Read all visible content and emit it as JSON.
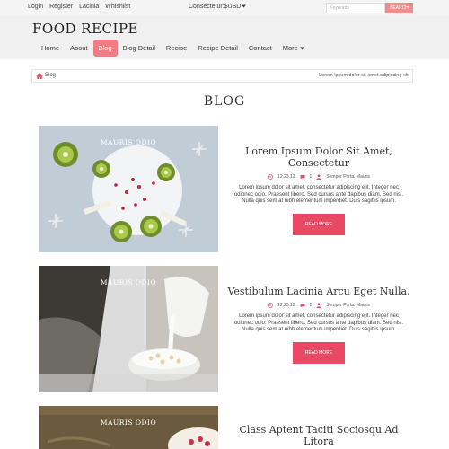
{
  "topbar": {
    "links": [
      "Login",
      "Register",
      "Lacinia",
      "Whishlist"
    ],
    "currency": "Consectetur:$USD",
    "search_placeholder": "Keywords",
    "search_button": "Search"
  },
  "header": {
    "logo": "FOOD RECIPE",
    "nav": [
      "Home",
      "About",
      "Blog",
      "Blog Detail",
      "Recipe",
      "Recipe Detail",
      "Contact",
      "More"
    ],
    "active_nav": "Blog"
  },
  "breadcrumb": {
    "current": "Blog",
    "tagline": "Lorem ipsum dolor sit amet adipiscing elit"
  },
  "page_title": "BLOG",
  "posts": [
    {
      "image_caption": "MAURIS ODIO",
      "title": "Lorem Ipsum Dolor Sit Amet, Consectetur",
      "date": "12.23.12",
      "comments": "1",
      "author": "Semper Porta. Mauris",
      "excerpt": "Lorem ipsum dolor sit amet, consectetur adipiscing elit. Integer nec odionec odio. Praesent libero. Sed cursus ante dapibus diam. Sed nisi. Nulla quis sem at nibh elementum imperdiet. Duis sagittis ipsum.",
      "button": "Read More"
    },
    {
      "image_caption": "MAURIS ODIO",
      "title": "Vestibulum Lacinia Arcu Eget Nulla.",
      "date": "12.23.12",
      "comments": "1",
      "author": "Semper Porta. Mauris",
      "excerpt": "Lorem ipsum dolor sit amet, consectetur adipiscing elit. Integer nec odionec odio. Praesent libero. Sed cursus ante dapibus diam. Sed nisi. Nulla quis sem at nibh elementum imperdiet. Duis sagittis ipsum.",
      "button": "Read More"
    },
    {
      "image_caption": "MAURIS ODIO",
      "title": "Class Aptent Taciti Sociosqu Ad Litora"
    }
  ],
  "colors": {
    "accent": "#e84a64",
    "nav_active": "#f07c85",
    "search_button": "#f08c8c",
    "header_bg": "#f0f0f0"
  },
  "icons": [
    "home-icon",
    "clock-icon",
    "comment-icon",
    "user-icon",
    "chevron-down-icon"
  ]
}
